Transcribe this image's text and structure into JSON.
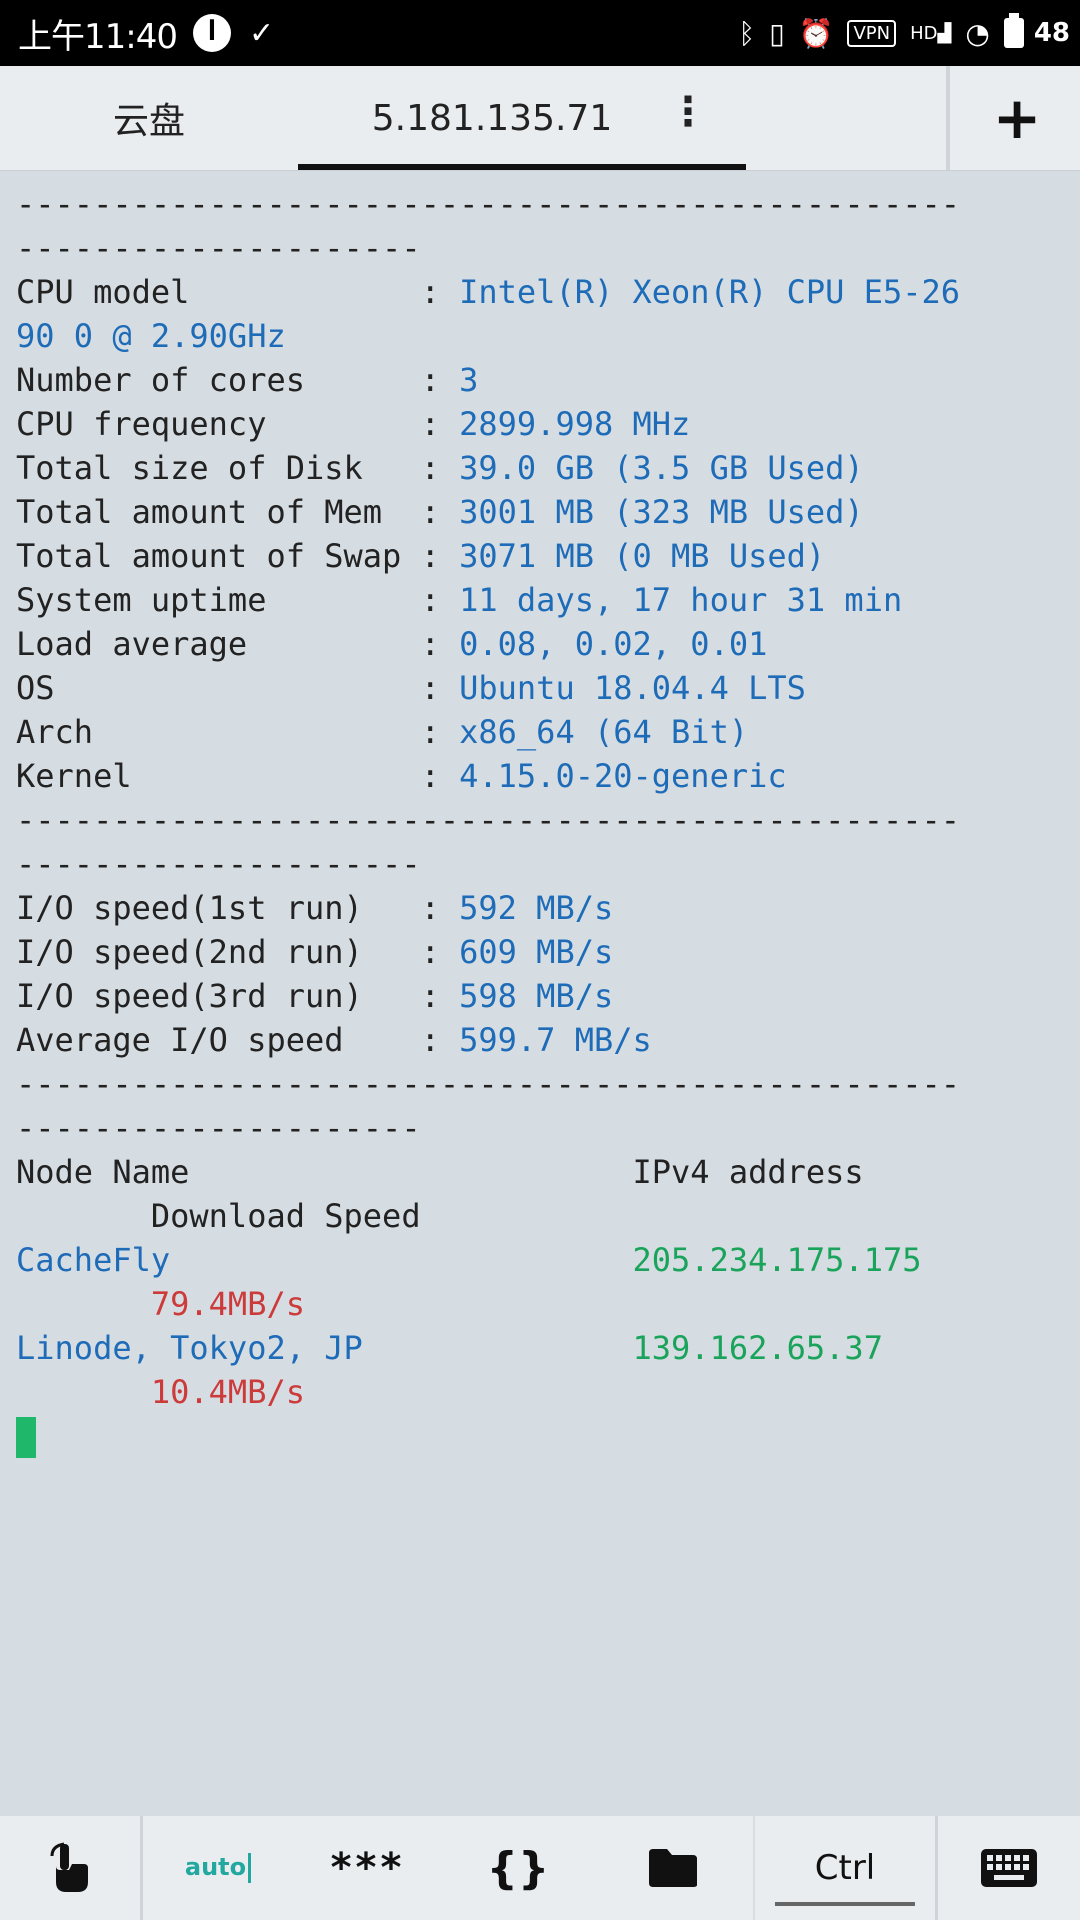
{
  "status_bar": {
    "time": "上午11:40",
    "battery": "48"
  },
  "tabs": {
    "inactive_label": "云盘",
    "active_label": "5.181.135.71",
    "more": "⋮",
    "add": "+"
  },
  "terminal": {
    "sep_a": "-------------------------------------------------",
    "sep_b": "---------------------",
    "rows1": [
      {
        "label": "CPU model            : ",
        "value": "Intel(R) Xeon(R) CPU E5-26"
      },
      {
        "label": "",
        "value": "90 0 @ 2.90GHz"
      },
      {
        "label": "Number of cores      : ",
        "value": "3"
      },
      {
        "label": "CPU frequency        : ",
        "value": "2899.998 MHz"
      },
      {
        "label": "Total size of Disk   : ",
        "value": "39.0 GB (3.5 GB Used)"
      },
      {
        "label": "Total amount of Mem  : ",
        "value": "3001 MB (323 MB Used)"
      },
      {
        "label": "Total amount of Swap : ",
        "value": "3071 MB (0 MB Used)"
      },
      {
        "label": "System uptime        : ",
        "value": "11 days, 17 hour 31 min"
      },
      {
        "label": "Load average         : ",
        "value": "0.08, 0.02, 0.01"
      },
      {
        "label": "OS                   : ",
        "value": "Ubuntu 18.04.4 LTS"
      },
      {
        "label": "Arch                 : ",
        "value": "x86_64 (64 Bit)"
      },
      {
        "label": "Kernel               : ",
        "value": "4.15.0-20-generic"
      }
    ],
    "rows2": [
      {
        "label": "I/O speed(1st run)   : ",
        "value": "592 MB/s"
      },
      {
        "label": "I/O speed(2nd run)   : ",
        "value": "609 MB/s"
      },
      {
        "label": "I/O speed(3rd run)   : ",
        "value": "598 MB/s"
      },
      {
        "label": "Average I/O speed    : ",
        "value": "599.7 MB/s"
      }
    ],
    "header_node": "Node Name                       ",
    "header_ip": "IPv4 address",
    "header_speed": "       Download Speed",
    "nodes": [
      {
        "name": "CacheFly                        ",
        "ip": "205.234.175.175",
        "speed": "       79.4MB/s"
      },
      {
        "name": "Linode, Tokyo2, JP              ",
        "ip": "139.162.65.37",
        "speed": "       10.4MB/s"
      }
    ]
  },
  "toolbar": {
    "auto": "auto",
    "stars": "***",
    "braces": "{}",
    "ctrl": "Ctrl"
  }
}
